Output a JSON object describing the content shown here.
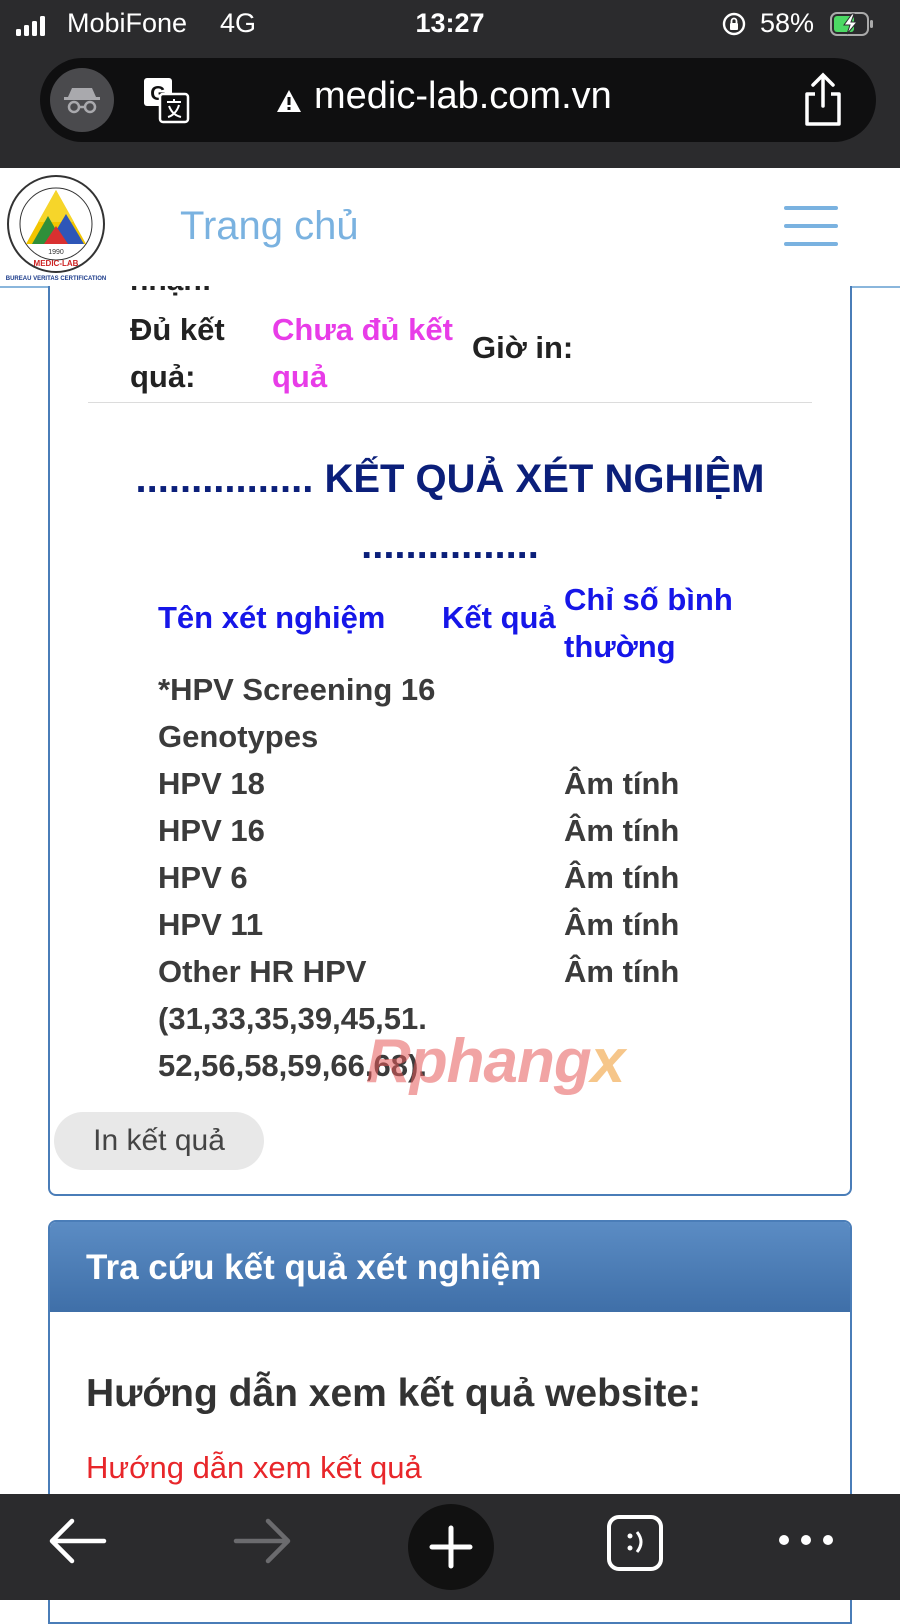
{
  "status_bar": {
    "carrier": "MobiFone",
    "network": "4G",
    "time": "13:27",
    "battery": "58%"
  },
  "browser": {
    "url": "medic-lab.com.vn"
  },
  "site": {
    "nav_home": "Trang chủ",
    "logo_text": "MEDIC-LAB 1990 ISO 9001:2008 ISO 14001:2004 BUREAU VERITAS CERTIFICATION"
  },
  "result_card": {
    "cut_label": "nhận:",
    "status_label": "Đủ kết quả:",
    "status_value": "Chưa đủ kết quả",
    "print_time_label": "Giờ in:",
    "title": "................ KẾT QUẢ XÉT NGHIỆM ................",
    "columns": {
      "name": "Tên xét nghiệm",
      "result": "Kết quả",
      "normal": "Chỉ số bình thường"
    },
    "rows": [
      {
        "name": "*HPV Screening 16 Genotypes",
        "result": ""
      },
      {
        "name": "HPV 18",
        "result": "Âm tính"
      },
      {
        "name": "HPV 16",
        "result": "Âm tính"
      },
      {
        "name": "HPV 6",
        "result": "Âm tính"
      },
      {
        "name": "HPV 11",
        "result": "Âm tính"
      },
      {
        "name": "Other HR HPV (31,33,35,39,45,51. 52,56,58,59,66,68).",
        "result": "Âm tính"
      }
    ],
    "print_button": "In kết quả",
    "watermark": {
      "main": "Rphang",
      "x": "x"
    }
  },
  "lookup_panel": {
    "title": "Tra cứu kết quả xét nghiệm",
    "guide_title": "Hướng dẫn xem kết quả website:",
    "guide_link": "Hướng dẫn xem kết quả"
  },
  "colors": {
    "accent": "#7ab2e0",
    "title_navy": "#0b1f7a",
    "header_blue": "#1616e8",
    "status_pink": "#e83ce8",
    "link_red": "#e8262a",
    "panel_blue": "#4a7db8"
  }
}
